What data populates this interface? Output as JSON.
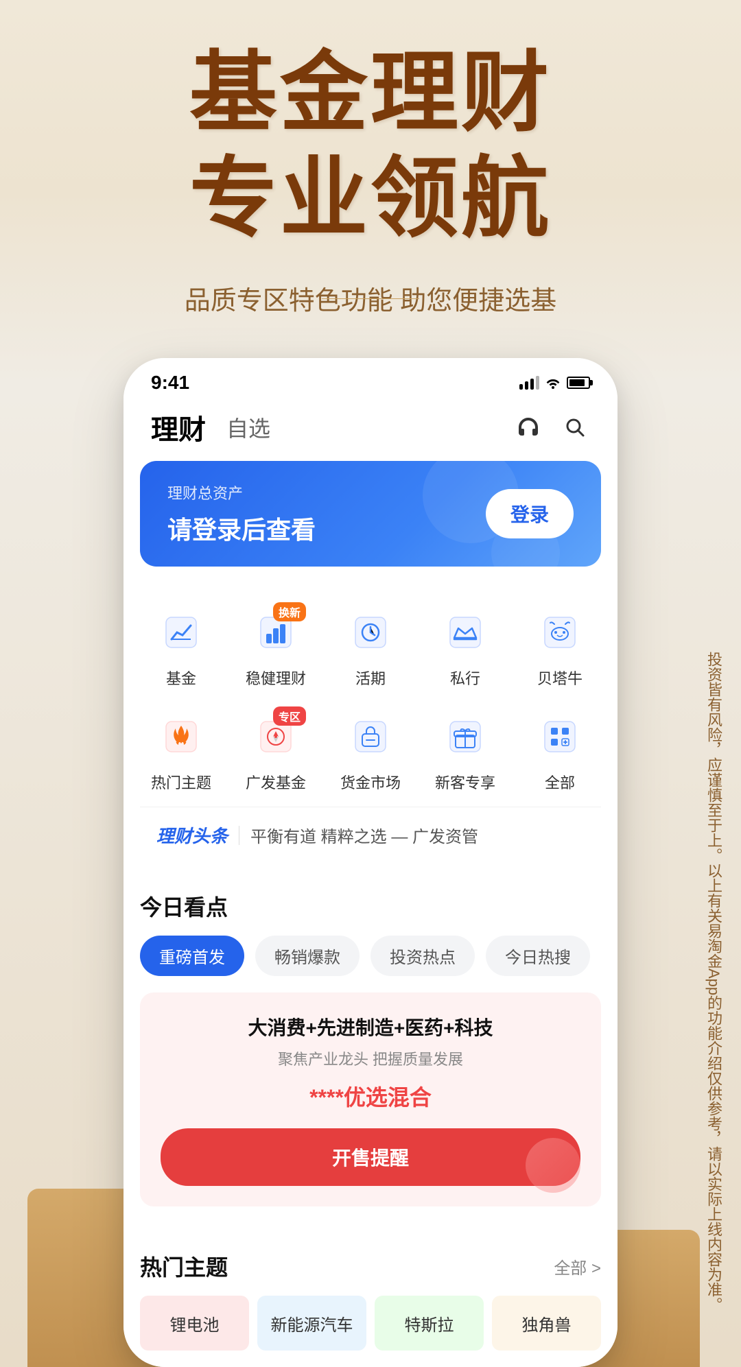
{
  "hero": {
    "title_line1": "基金理财",
    "title_line2": "专业领航",
    "subtitle": "品质专区特色功能 助您便捷选基"
  },
  "phone": {
    "status_bar": {
      "time": "9:41"
    },
    "nav": {
      "title_main": "理财",
      "title_sub": "自选"
    },
    "banner": {
      "label": "理财总资产",
      "main_text": "请登录后查看",
      "login_btn": "登录"
    },
    "menu": {
      "items": [
        {
          "label": "基金",
          "icon": "chart-icon",
          "badge": ""
        },
        {
          "label": "稳健理财",
          "icon": "bar-icon",
          "badge": "换新"
        },
        {
          "label": "活期",
          "icon": "clock-icon",
          "badge": ""
        },
        {
          "label": "私行",
          "icon": "crown-icon",
          "badge": ""
        },
        {
          "label": "贝塔牛",
          "icon": "cow-icon",
          "badge": ""
        },
        {
          "label": "热门主题",
          "icon": "fire-icon",
          "badge": ""
        },
        {
          "label": "广发基金",
          "icon": "compass-icon",
          "badge": "专区"
        },
        {
          "label": "货金市场",
          "icon": "bag-icon",
          "badge": ""
        },
        {
          "label": "新客专享",
          "icon": "gift-icon",
          "badge": ""
        },
        {
          "label": "全部",
          "icon": "grid-icon",
          "badge": ""
        }
      ]
    },
    "news_ticker": {
      "brand": "理财头条",
      "text": "平衡有道 精粹之选 — 广发资管"
    },
    "today_section": {
      "title": "今日看点",
      "tabs": [
        {
          "label": "重磅首发",
          "active": true
        },
        {
          "label": "畅销爆款",
          "active": false
        },
        {
          "label": "投资热点",
          "active": false
        },
        {
          "label": "今日热搜",
          "active": false
        }
      ],
      "fund_card": {
        "title": "大消费+先进制造+医药+科技",
        "desc": "聚焦产业龙头 把握质量发展",
        "name": "****优选混合",
        "btn_label": "开售提醒"
      }
    },
    "hot_section": {
      "title": "热门主题",
      "more_label": "全部 >",
      "themes": [
        {
          "label": "锂电池"
        },
        {
          "label": "新能源汽车"
        },
        {
          "label": "特斯拉"
        },
        {
          "label": "独角兽"
        }
      ]
    }
  },
  "side_text": "投资皆有风险，应谨慎至于上。以上有关易淘金App的功能介绍仅供参考，请以实际上线内容为准。",
  "colors": {
    "brand_blue": "#2563eb",
    "brand_red": "#ef4444",
    "hero_brown": "#7a3a0a",
    "accent_gold": "#c09050"
  }
}
